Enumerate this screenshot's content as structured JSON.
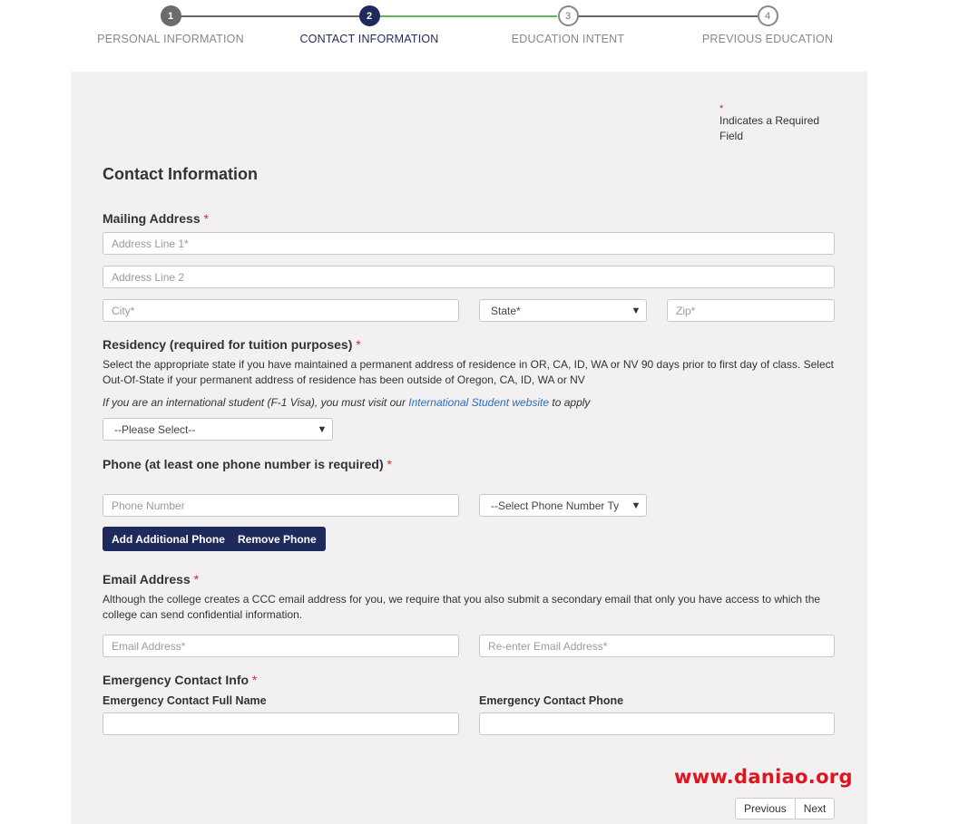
{
  "stepper": {
    "steps": [
      {
        "number": "1",
        "label": "PERSONAL INFORMATION",
        "state": "done"
      },
      {
        "number": "2",
        "label": "CONTACT INFORMATION",
        "state": "active"
      },
      {
        "number": "3",
        "label": "EDUCATION INTENT",
        "state": "todo"
      },
      {
        "number": "4",
        "label": "PREVIOUS EDUCATION",
        "state": "todo"
      }
    ]
  },
  "required_note": {
    "star": "*",
    "text": "Indicates a Required Field"
  },
  "form": {
    "title": "Contact Information",
    "mailing": {
      "label": "Mailing Address",
      "required_mark": "*",
      "address1_placeholder": "Address Line 1*",
      "address2_placeholder": "Address Line 2",
      "city_placeholder": "City*",
      "state_selected": "State*",
      "zip_placeholder": "Zip*"
    },
    "residency": {
      "label": "Residency (required for tuition purposes)",
      "required_mark": "*",
      "help": "Select the appropriate state if you have maintained a permanent address of residence in OR, CA, ID, WA or NV 90 days prior to first day of class. Select Out-Of-State if your permanent address of residence has been outside of Oregon, CA, ID, WA or NV",
      "intl_prefix": "If you are an international student (F-1 Visa), you must visit our ",
      "intl_link": "International Student website",
      "intl_suffix": " to apply",
      "select_selected": "--Please Select--"
    },
    "phone": {
      "label": "Phone (at least one phone number is required)",
      "required_mark": "*",
      "number_placeholder": "Phone Number",
      "type_selected": "--Select Phone Number Ty",
      "add_button": "Add Additional Phone",
      "remove_button": "Remove Phone"
    },
    "email": {
      "label": "Email Address",
      "required_mark": "*",
      "help": "Although the college creates a CCC email address for you, we require that you also submit a secondary email that only you have access to which the college can send confidential information.",
      "email_placeholder": "Email Address*",
      "reenter_placeholder": "Re-enter Email Address*"
    },
    "emergency": {
      "label": "Emergency Contact Info",
      "required_mark": "*",
      "name_label": "Emergency Contact Full Name",
      "phone_label": "Emergency Contact Phone"
    }
  },
  "pager": {
    "previous": "Previous",
    "next": "Next"
  },
  "watermark": "www.daniao.org",
  "colors": {
    "primary": "#1f2a5c",
    "progress": "#5cb85c",
    "required": "#c9302c",
    "link": "#2a6ebb",
    "panel": "#f2f0f1"
  }
}
